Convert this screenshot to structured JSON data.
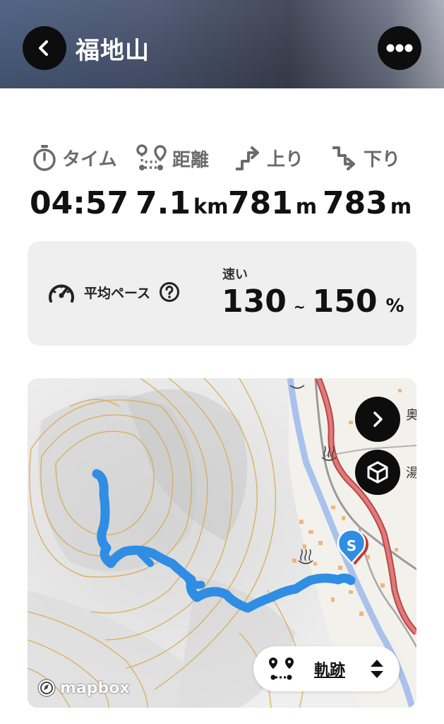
{
  "header": {
    "title": "福地山"
  },
  "stats": {
    "time_label": "タイム",
    "distance_label": "距離",
    "ascent_label": "上り",
    "descent_label": "下り",
    "time_value": "04:57",
    "distance_value": "7.1",
    "distance_unit": "km",
    "ascent_value": "781",
    "ascent_unit": "m",
    "descent_value": "783",
    "descent_unit": "m"
  },
  "pace": {
    "label": "平均ペース",
    "speed_tag": "速い",
    "min": "130",
    "tilde": "~",
    "max": "150",
    "unit": "%"
  },
  "map": {
    "start_marker": "S",
    "poi_labels": [
      "奥",
      "湯"
    ],
    "track_toggle_label": "軌跡",
    "attribution": "mapbox",
    "track_color": "#2f8de4"
  },
  "icons": {
    "back": "chevron-left-icon",
    "more": "more-dots-icon",
    "timer": "stopwatch-icon",
    "distance": "route-icon",
    "ascent": "ascent-icon",
    "descent": "descent-icon",
    "pace": "speedometer-icon",
    "help": "question-circle-icon",
    "next": "chevron-right-icon",
    "view3d": "cube-icon",
    "track": "route-icon",
    "sort": "up-down-arrows-icon",
    "hot_spring": "hot-spring-icon"
  }
}
